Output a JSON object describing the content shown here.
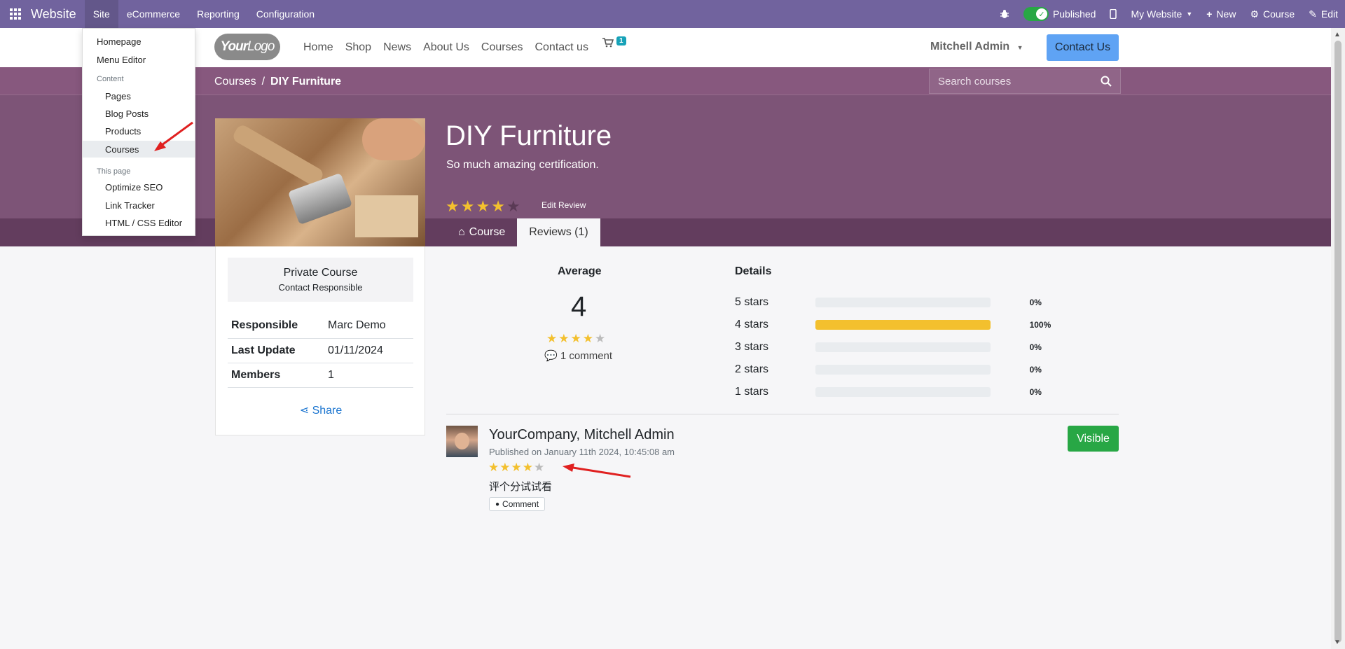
{
  "odoo_nav": {
    "brand": "Website",
    "menus": [
      "Site",
      "eCommerce",
      "Reporting",
      "Configuration"
    ],
    "published": "Published",
    "my_website": "My Website",
    "new": "New",
    "course": "Course",
    "edit": "Edit"
  },
  "site_dropdown": {
    "homepage": "Homepage",
    "menu_editor": "Menu Editor",
    "content_header": "Content",
    "pages": "Pages",
    "blog_posts": "Blog Posts",
    "products": "Products",
    "courses": "Courses",
    "this_page_header": "This page",
    "optimize_seo": "Optimize SEO",
    "link_tracker": "Link Tracker",
    "html_css_editor": "HTML / CSS Editor"
  },
  "site_header": {
    "logo_part1": "Your",
    "logo_part2": "Logo",
    "links": [
      "Home",
      "Shop",
      "News",
      "About Us",
      "Courses",
      "Contact us"
    ],
    "cart_count": "1",
    "user": "Mitchell Admin",
    "contact_button": "Contact Us"
  },
  "hero": {
    "breadcrumb_parent": "Courses",
    "breadcrumb_sep": "/",
    "breadcrumb_current": "DIY Furniture",
    "search_placeholder": "Search courses",
    "title": "DIY Furniture",
    "subtitle": "So much amazing certification.",
    "rating": 4,
    "edit_review": "Edit Review",
    "tab_course": "Course",
    "tab_reviews": "Reviews (1)"
  },
  "course_card": {
    "private_title": "Private Course",
    "private_sub": "Contact Responsible",
    "rows": [
      {
        "key": "Responsible",
        "value": "Marc Demo"
      },
      {
        "key": "Last Update",
        "value": "01/11/2024"
      },
      {
        "key": "Members",
        "value": "1"
      }
    ],
    "share": "Share"
  },
  "reviews": {
    "average_label": "Average",
    "average_value": "4",
    "average_rating": 4,
    "comment_count": "1 comment",
    "details_label": "Details",
    "details": [
      {
        "label": "5 stars",
        "percent": "0%",
        "fraction": 0
      },
      {
        "label": "4 stars",
        "percent": "100%",
        "fraction": 1
      },
      {
        "label": "3 stars",
        "percent": "0%",
        "fraction": 0
      },
      {
        "label": "2 stars",
        "percent": "0%",
        "fraction": 0
      },
      {
        "label": "1 stars",
        "percent": "0%",
        "fraction": 0
      }
    ],
    "review": {
      "author": "YourCompany, Mitchell Admin",
      "date": "Published on January 11th 2024, 10:45:08 am",
      "rating": 4,
      "text": "评个分试试看",
      "comment_button": "Comment",
      "visible_button": "Visible"
    }
  },
  "colors": {
    "odoo_purple": "#71639e",
    "hero_purple": "#7d5477",
    "star": "#f3c02e",
    "visible_green": "#28a745",
    "contact_blue": "#5fa3f4"
  }
}
